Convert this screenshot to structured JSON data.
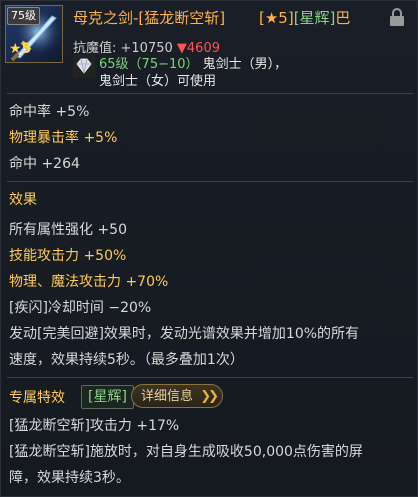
{
  "header": {
    "level_badge": "75级",
    "star_mark": "★5",
    "item_name": "母克之剑-[猛龙断空斩]",
    "grade_star": "[★5]",
    "grade_tag": "[星辉]",
    "grade_suffix": "巴",
    "resist_label": "抗魔值: +10750",
    "resist_delta": "▼4609",
    "req_level": "65级（75−10）",
    "req_class_1": "鬼剑士（男），",
    "req_class_2": "鬼剑士（女）可使用"
  },
  "stats": {
    "hit_rate": "命中率 +5%",
    "phys_crit": "物理暴击率 +5%",
    "hit": "命中 +264"
  },
  "effects": {
    "title": "效果",
    "all_attr": "所有属性强化 +50",
    "skill_atk": "技能攻击力 +50%",
    "phys_mag_atk": "物理、魔法攻击力 +70%",
    "cooldown": "[疾闪]冷却时间 −20%",
    "perfect_dodge_1": "发动[完美回避]效果时，发动光谱效果并增加10%的所有",
    "perfect_dodge_2": "速度，效果持续5秒。（最多叠加1次）"
  },
  "special": {
    "title": "专属特效",
    "tag": "[星辉]",
    "detail_button": "详细信息",
    "skill_atk": "[猛龙断空斩]攻击力 +17%",
    "shield_1": "[猛龙断空斩]施放时，对自身生成吸收50,000点伤害的屏",
    "shield_2": "障，效果持续3秒。"
  },
  "icons": {
    "item": "sword-item-icon",
    "lock": "lock-icon",
    "gem": "diamond-icon",
    "detail_arrows": "double-chevron-right-icon"
  },
  "colors": {
    "gold": "#ffcc55",
    "orange_name": "#ffb24a",
    "green": "#8ad48a",
    "red": "#ff5252"
  }
}
